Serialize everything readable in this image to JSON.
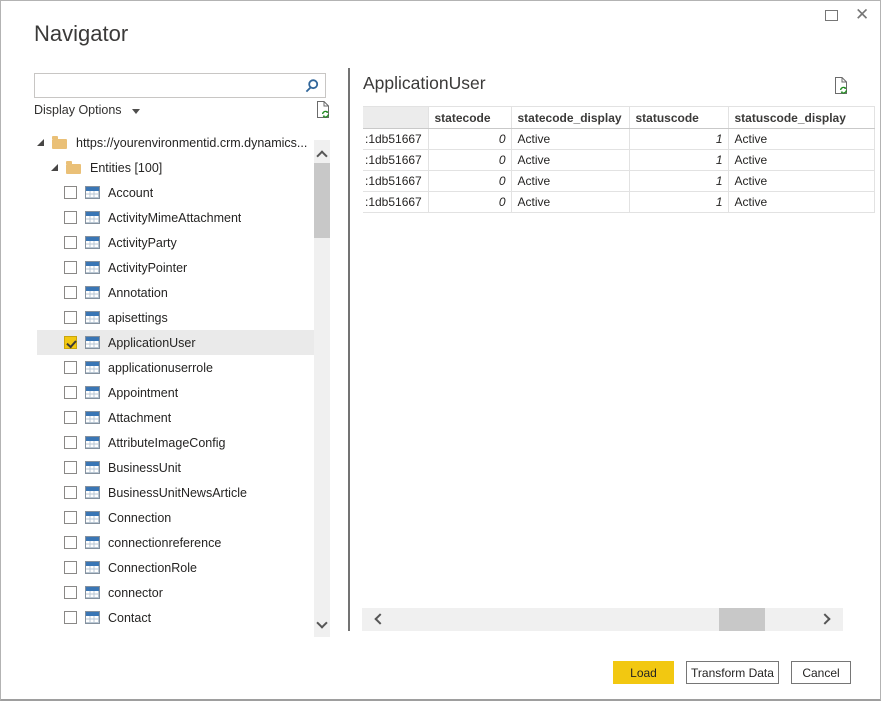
{
  "window": {
    "title": "Navigator"
  },
  "left_panel": {
    "search": {
      "value": "",
      "placeholder": ""
    },
    "display_options": {
      "label": "Display Options"
    },
    "tree": {
      "root": {
        "label": "https://yourenvironmentid.crm.dynamics...",
        "expanded": true
      },
      "folder": {
        "label": "Entities [100]",
        "expanded": true
      },
      "items": [
        {
          "label": "Account",
          "checked": false,
          "selected": false
        },
        {
          "label": "ActivityMimeAttachment",
          "checked": false,
          "selected": false
        },
        {
          "label": "ActivityParty",
          "checked": false,
          "selected": false
        },
        {
          "label": "ActivityPointer",
          "checked": false,
          "selected": false
        },
        {
          "label": "Annotation",
          "checked": false,
          "selected": false
        },
        {
          "label": "apisettings",
          "checked": false,
          "selected": false
        },
        {
          "label": "ApplicationUser",
          "checked": true,
          "selected": true
        },
        {
          "label": "applicationuserrole",
          "checked": false,
          "selected": false
        },
        {
          "label": "Appointment",
          "checked": false,
          "selected": false
        },
        {
          "label": "Attachment",
          "checked": false,
          "selected": false
        },
        {
          "label": "AttributeImageConfig",
          "checked": false,
          "selected": false
        },
        {
          "label": "BusinessUnit",
          "checked": false,
          "selected": false
        },
        {
          "label": "BusinessUnitNewsArticle",
          "checked": false,
          "selected": false
        },
        {
          "label": "Connection",
          "checked": false,
          "selected": false
        },
        {
          "label": "connectionreference",
          "checked": false,
          "selected": false
        },
        {
          "label": "ConnectionRole",
          "checked": false,
          "selected": false
        },
        {
          "label": "connector",
          "checked": false,
          "selected": false
        },
        {
          "label": "Contact",
          "checked": false,
          "selected": false
        }
      ]
    }
  },
  "preview": {
    "title": "ApplicationUser",
    "table": {
      "columns": [
        "",
        "statecode",
        "statecode_display",
        "statuscode",
        "statuscode_display"
      ],
      "rows": [
        [
          ":1db51667",
          "0",
          "Active",
          "1",
          "Active"
        ],
        [
          ":1db51667",
          "0",
          "Active",
          "1",
          "Active"
        ],
        [
          ":1db51667",
          "0",
          "Active",
          "1",
          "Active"
        ],
        [
          ":1db51667",
          "0",
          "Active",
          "1",
          "Active"
        ]
      ]
    }
  },
  "footer": {
    "load": "Load",
    "transform": "Transform Data",
    "cancel": "Cancel"
  },
  "colors": {
    "accent_yellow": "#F2C811",
    "selected_row_bg": "#EAEAEA",
    "folder": "#EAC077",
    "table_icon_blue": "#3A76B5",
    "search_icon_blue": "#31669A",
    "refresh_green": "#1E8A1E",
    "divider": "#737373"
  }
}
